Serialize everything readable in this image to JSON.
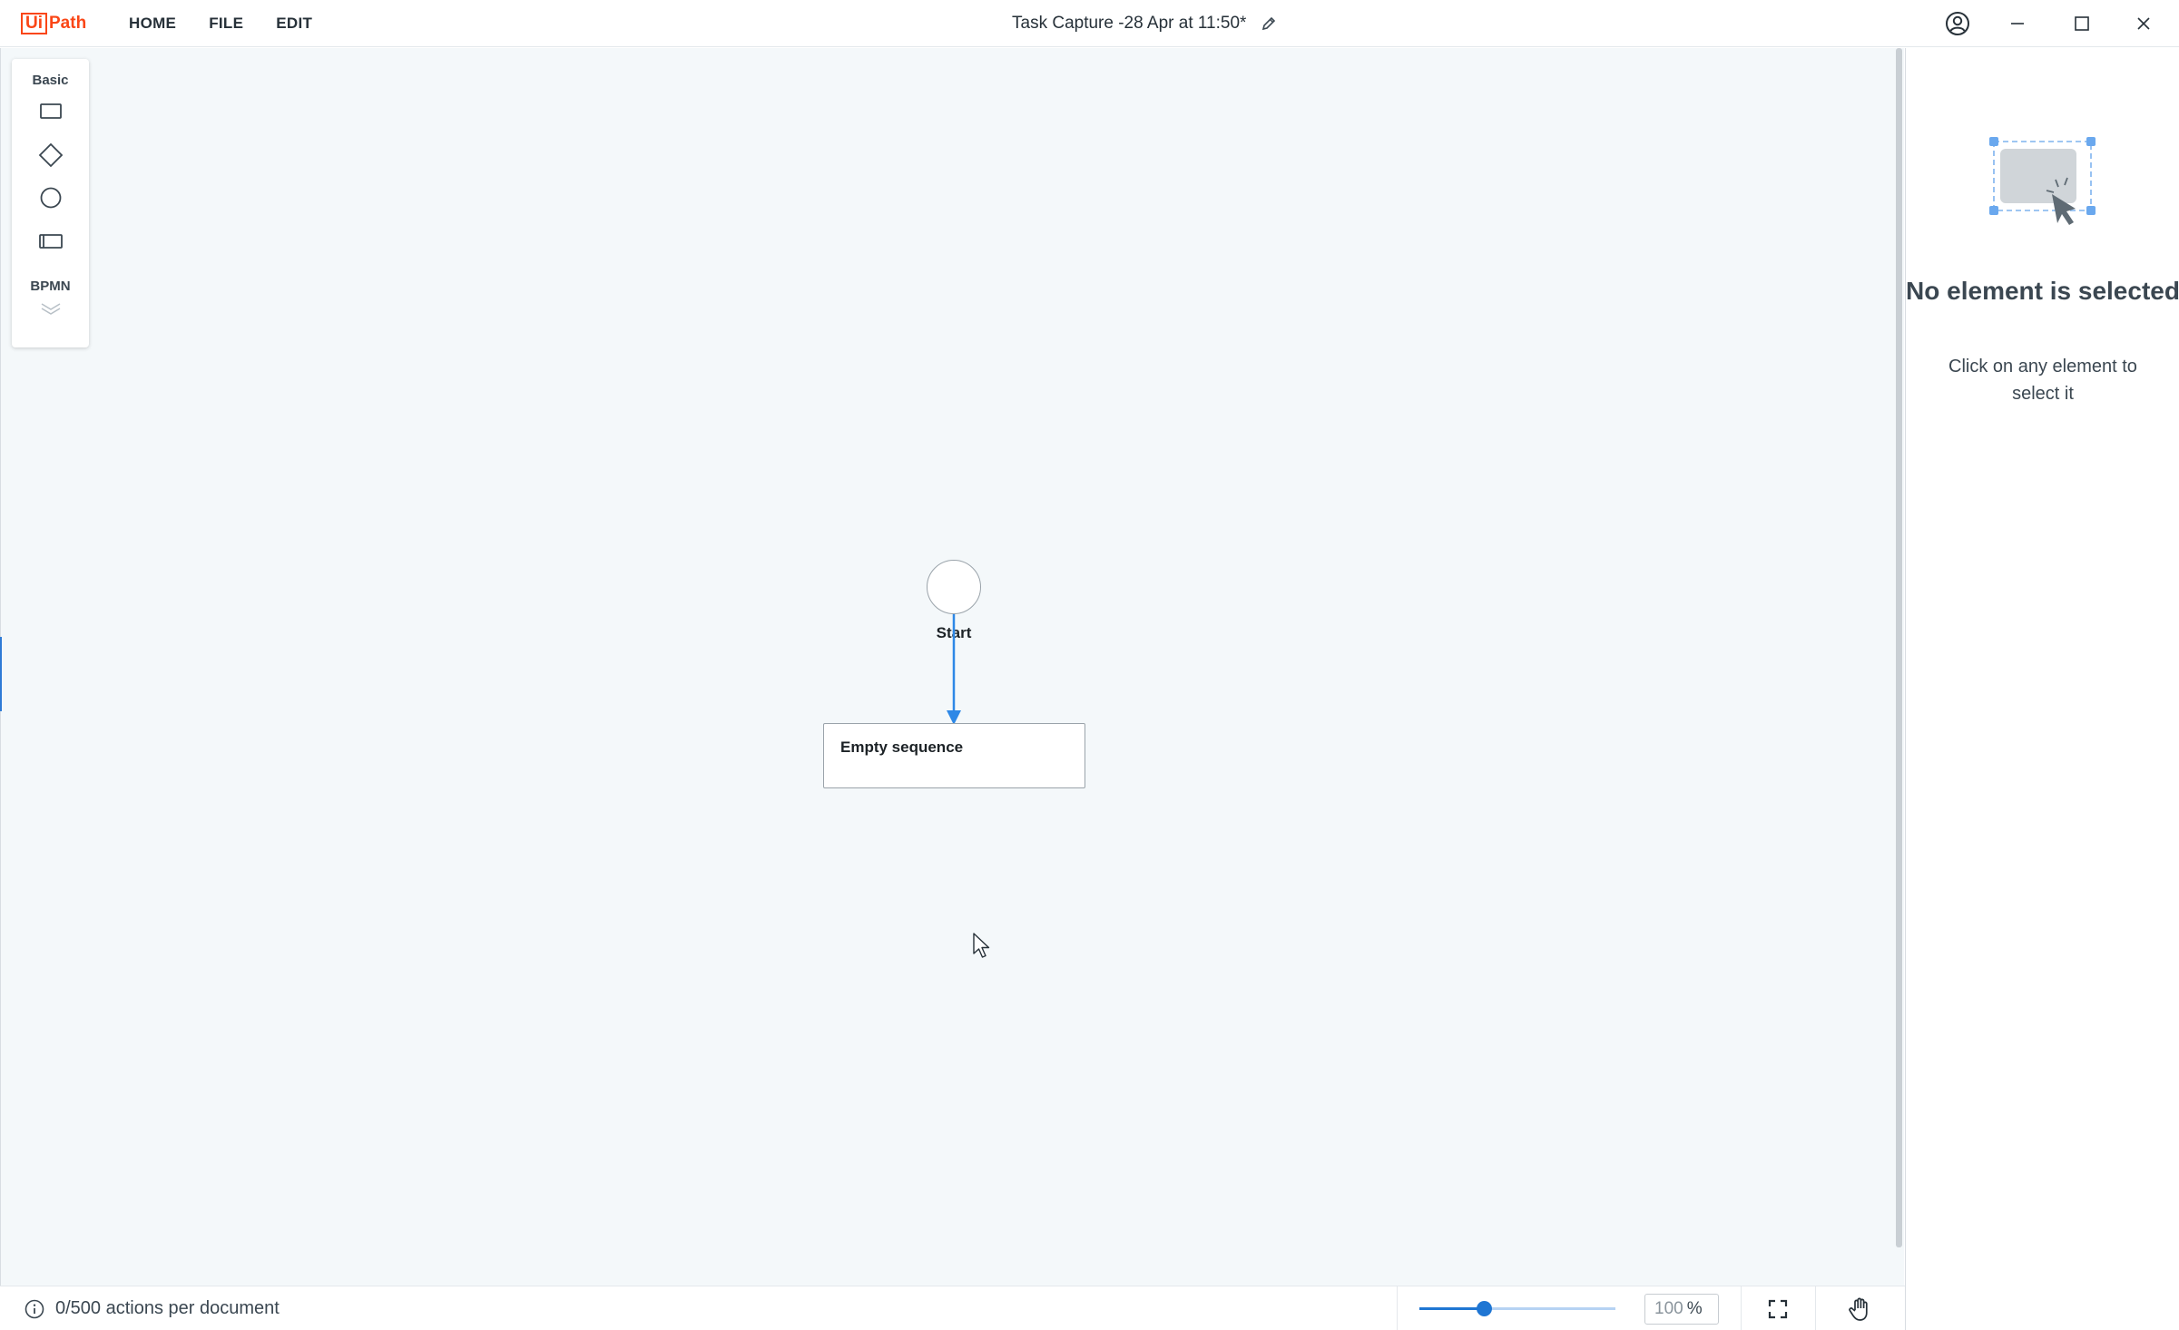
{
  "app": {
    "logo_prefix": "Ui",
    "logo_suffix": "Path",
    "document_title": "Task Capture -28 Apr at 11:50*"
  },
  "menu": {
    "items": [
      {
        "label": "HOME"
      },
      {
        "label": "FILE"
      },
      {
        "label": "EDIT"
      }
    ]
  },
  "palette": {
    "basic_label": "Basic",
    "bpmn_label": "BPMN",
    "tools": [
      "rectangle-icon",
      "diamond-icon",
      "circle-icon",
      "sub-process-icon"
    ]
  },
  "diagram": {
    "start_label": "Start",
    "sequence_label": "Empty sequence"
  },
  "properties_panel": {
    "empty_title": "No element is selected",
    "empty_subtitle": "Click on any element to select it"
  },
  "status": {
    "actions_text": "0/500 actions per document",
    "zoom_value": "100",
    "zoom_unit": "%",
    "zoom_slider_fraction": 0.33
  },
  "colors": {
    "brand": "#fa4616",
    "accent": "#1f76d3",
    "canvas_bg": "#f4f8fa"
  }
}
